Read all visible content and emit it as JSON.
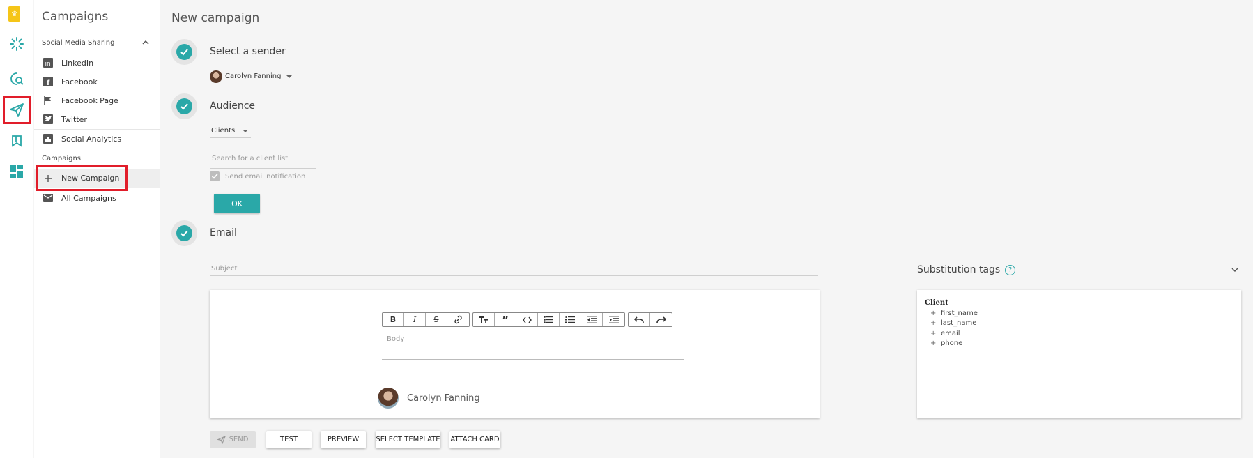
{
  "rail": {
    "items": [
      {
        "name": "brand-logo-icon",
        "glyph": "♛"
      },
      {
        "name": "spinner-loader-icon"
      },
      {
        "name": "chat-search-icon"
      },
      {
        "name": "paper-plane-icon"
      },
      {
        "name": "bookmark-flag-icon"
      },
      {
        "name": "dashboard-grid-icon"
      }
    ],
    "accent_color": "#2aa8a8",
    "highlight_color": "#e11d2a"
  },
  "sidebar": {
    "title": "Campaigns",
    "section1_label": "Social Media Sharing",
    "social_items": [
      {
        "label": "LinkedIn",
        "icon": "linkedin-icon"
      },
      {
        "label": "Facebook",
        "icon": "facebook-icon"
      },
      {
        "label": "Facebook Page",
        "icon": "flag-icon"
      },
      {
        "label": "Twitter",
        "icon": "twitter-icon"
      }
    ],
    "analytics_label": "Social Analytics",
    "section2_label": "Campaigns",
    "new_campaign_label": "New Campaign",
    "all_campaigns_label": "All Campaigns"
  },
  "main": {
    "title": "New campaign",
    "step1_label": "Select a sender",
    "sender_value": "Carolyn Fanning",
    "step2_label": "Audience",
    "audience_value": "Clients",
    "client_search_placeholder": "Search for a client list",
    "email_notification_label": "Send email notification",
    "ok_label": "OK",
    "step3_label": "Email",
    "subject_placeholder": "Subject",
    "body_placeholder": "Body",
    "signature_name": "Carolyn Fanning"
  },
  "substitution": {
    "title": "Substitution tags",
    "group_label": "Client",
    "tags": [
      "first_name",
      "last_name",
      "email",
      "phone"
    ]
  },
  "actions": {
    "send": "SEND",
    "test": "TEST",
    "preview": "PREVIEW",
    "select_template": "SELECT TEMPLATE",
    "attach_card": "ATTACH CARD"
  }
}
